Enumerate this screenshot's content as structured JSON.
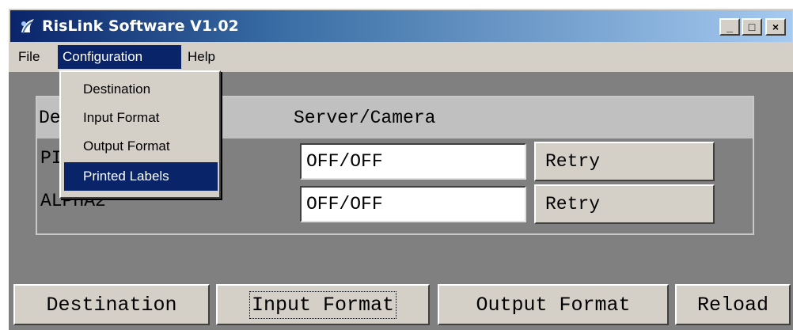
{
  "window": {
    "title": "RisLink Software  V1.02",
    "controls": {
      "minimize": "_",
      "maximize": "□",
      "close": "×"
    }
  },
  "menubar": {
    "items": [
      {
        "label": "File"
      },
      {
        "label": "Configuration",
        "active": true
      },
      {
        "label": "Help"
      }
    ]
  },
  "config_menu": {
    "items": [
      {
        "label": "Destination"
      },
      {
        "label": "Input Format"
      },
      {
        "label": "Output Format"
      },
      {
        "label": "Printed Labels",
        "highlighted": true
      }
    ]
  },
  "device_table": {
    "headers": {
      "device": "De",
      "status": "Server/Camera"
    },
    "rows": [
      {
        "device": "PI",
        "status": "OFF/OFF",
        "action": "Retry"
      },
      {
        "device": "ALPHA2",
        "status": "OFF/OFF",
        "action": "Retry"
      }
    ]
  },
  "bottom_buttons": {
    "destination": "Destination",
    "input_format": "Input Format",
    "output_format": "Output Format",
    "reload": "Reload"
  },
  "colors": {
    "title_bar": "#0a246a",
    "face": "#d4d0c8",
    "client": "#808080",
    "highlight": "#0a246a"
  },
  "icons": {
    "app": "rislink-app-icon",
    "minimize": "minimize-icon",
    "maximize": "maximize-icon",
    "close": "close-icon"
  }
}
